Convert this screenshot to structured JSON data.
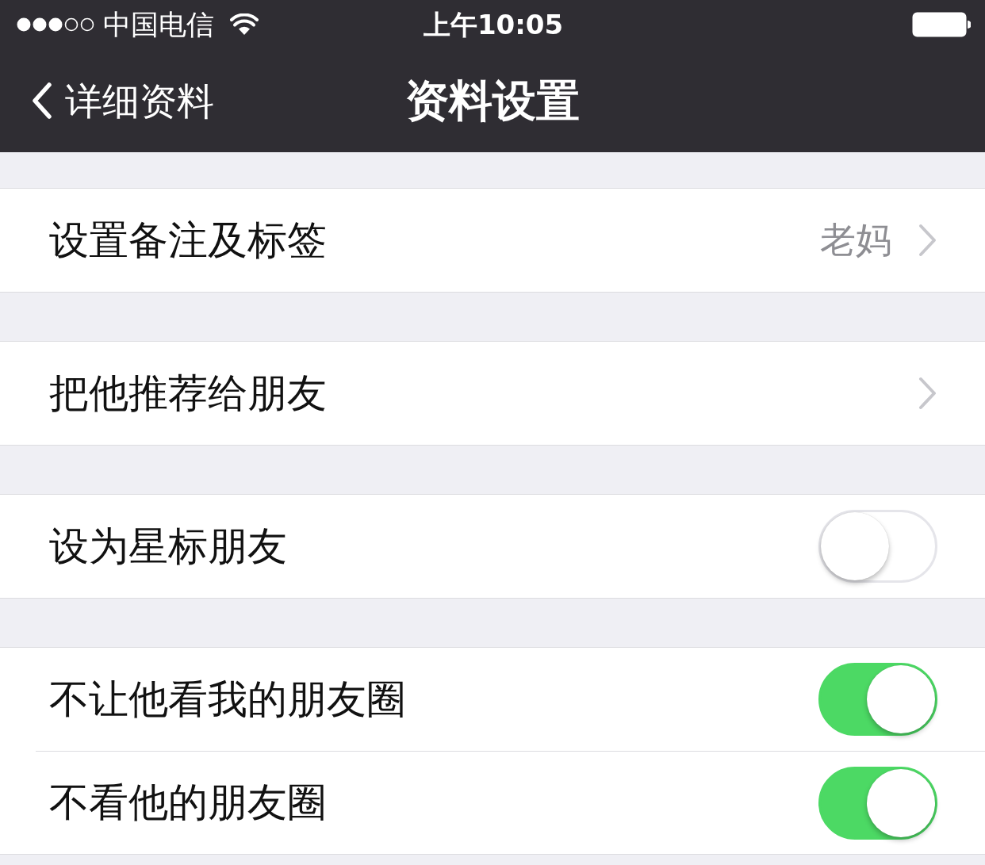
{
  "status_bar": {
    "carrier": "中国电信",
    "time": "上午10:05"
  },
  "nav_bar": {
    "back": {
      "label": "详细资料"
    },
    "title": "资料设置"
  },
  "sections": [
    {
      "rows": [
        {
          "kind": "link",
          "label": "设置备注及标签",
          "value": "老妈"
        }
      ]
    },
    {
      "rows": [
        {
          "kind": "link",
          "label": "把他推荐给朋友"
        }
      ]
    },
    {
      "rows": [
        {
          "kind": "toggle",
          "label": "设为星标朋友",
          "on": false
        }
      ]
    },
    {
      "rows": [
        {
          "kind": "toggle",
          "label": "不让他看我的朋友圈",
          "on": true
        },
        {
          "kind": "toggle",
          "label": "不看他的朋友圈",
          "on": true
        }
      ]
    }
  ]
}
